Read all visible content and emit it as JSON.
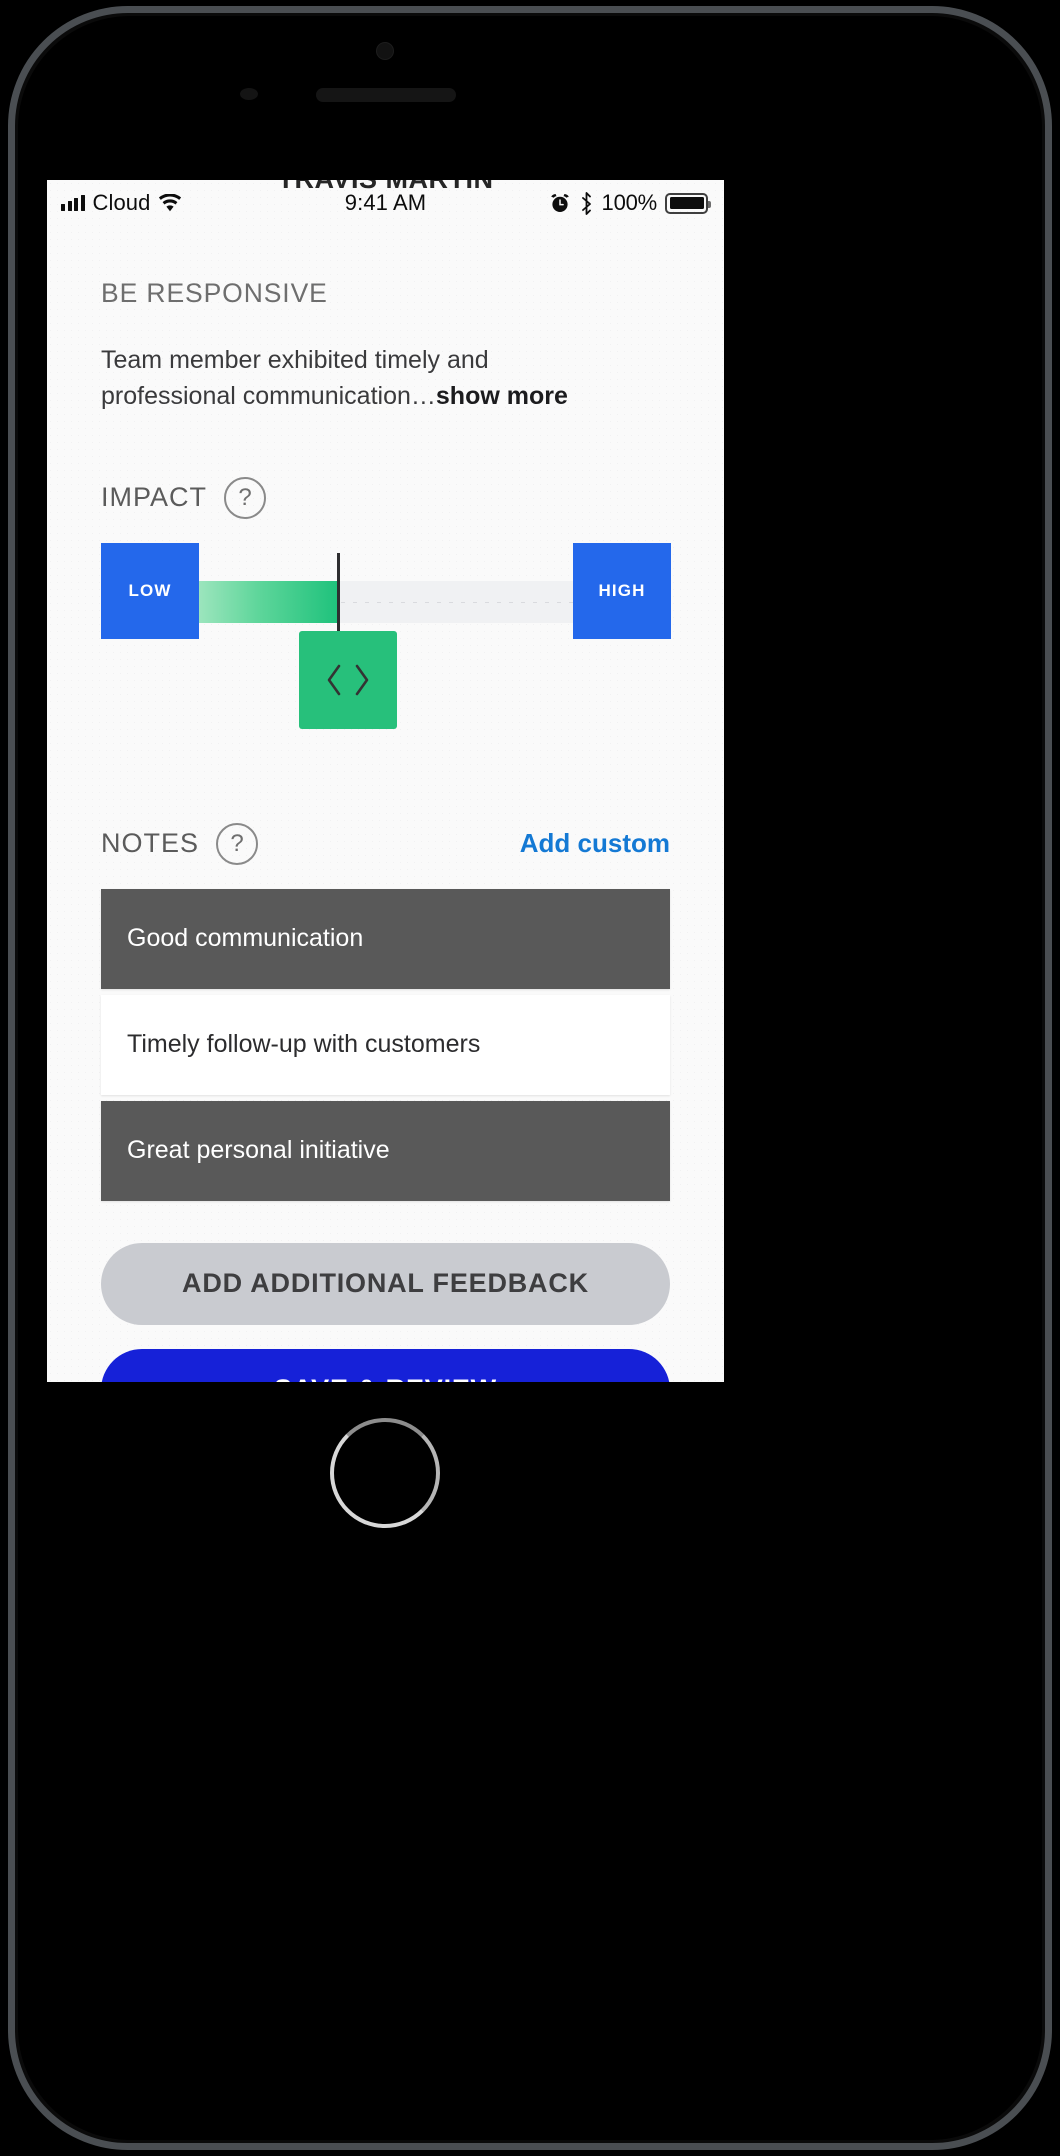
{
  "statusbar": {
    "carrier": "Cloud",
    "time": "9:41 AM",
    "battery_pct": "100%",
    "signal_icon": "signal-bars-icon",
    "wifi_icon": "wifi-icon",
    "alarm_icon": "alarm-clock-icon",
    "bluetooth_icon": "bluetooth-icon",
    "battery_icon": "battery-full-icon"
  },
  "nav": {
    "title": "TRAVIS MARTIN"
  },
  "review": {
    "competency": "BE RESPONSIVE",
    "description": "Team member exhibited timely and professional communication…",
    "show_more_label": "show more"
  },
  "impact": {
    "label": "IMPACT",
    "help_icon": "question-mark-icon",
    "help_glyph": "?",
    "low_label": "LOW",
    "high_label": "HIGH",
    "value_percent": 41,
    "fill_color": "#1fc27c",
    "cap_color": "#2468eb",
    "thumb_color": "#27c07b",
    "track_color": "#f0f1f3",
    "thumb_icon": "drag-handle-chevrons-icon"
  },
  "notes": {
    "label": "NOTES",
    "help_icon": "question-mark-icon",
    "help_glyph": "?",
    "add_custom_label": "Add custom",
    "add_custom_color": "#1479d4",
    "items": [
      {
        "text": "Good communication",
        "selected": true
      },
      {
        "text": "Timely follow-up with customers",
        "selected": false
      },
      {
        "text": "Great personal initiative",
        "selected": true
      }
    ]
  },
  "actions": {
    "secondary_label": "ADD ADDITIONAL FEEDBACK",
    "secondary_color": "#c9cbd0",
    "primary_label": "SAVE & REVIEW",
    "primary_color": "#1621d8"
  }
}
